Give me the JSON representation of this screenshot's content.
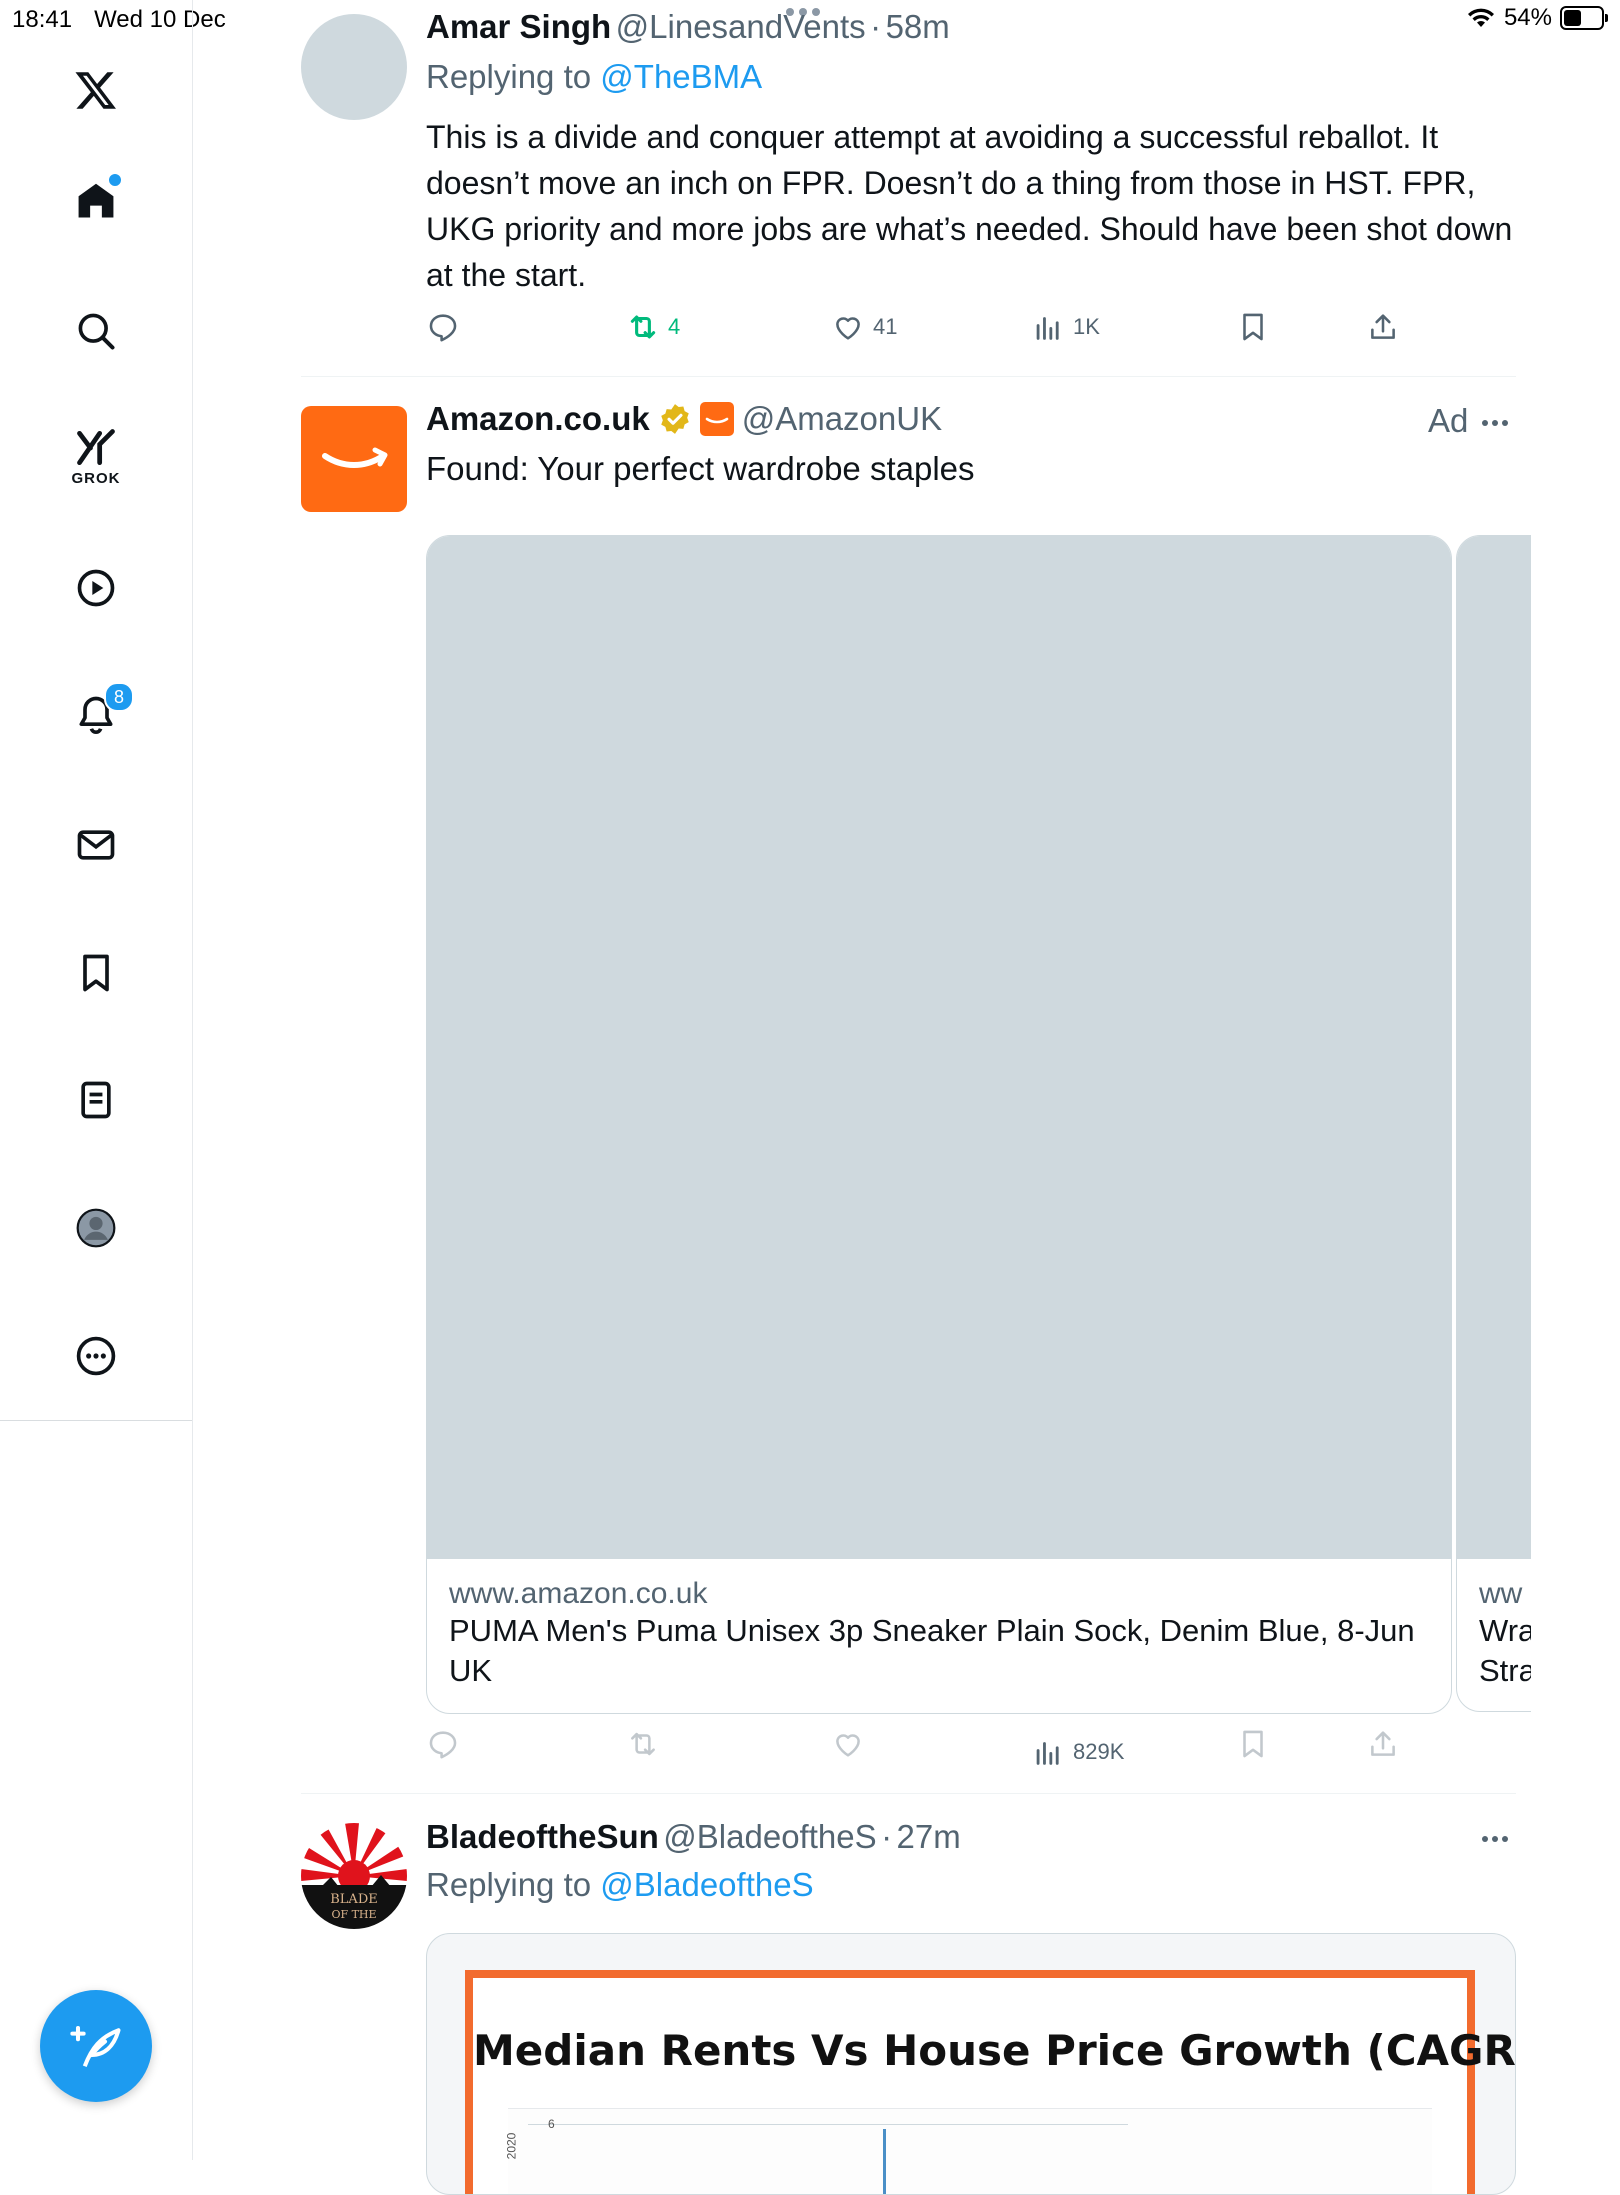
{
  "status": {
    "time": "18:41",
    "date": "Wed 10 Dec",
    "battery": "54%",
    "battery_level": 0.54
  },
  "sidebar": {
    "grok_label": "GROK",
    "notifications_count": "8"
  },
  "tweet1": {
    "name": "Amar Singh",
    "handle": "@LinesandVents",
    "sep": "·",
    "time": "58m",
    "replying_prefix": "Replying to",
    "replying_handle": "@TheBMA",
    "text": "This is a divide and conquer attempt at avoiding a successful reballot. It doesn’t move an inch on FPR. Doesn’t do a thing from those in HST. FPR, UKG priority and more jobs are what’s needed. Should have been shot down at the start.",
    "retweets": "4",
    "likes": "41",
    "views": "1K"
  },
  "ad": {
    "name": "Amazon.co.uk",
    "handle": "@AmazonUK",
    "ad_label": "Ad",
    "text": "Found: Your perfect wardrobe staples",
    "card1": {
      "domain": "www.amazon.co.uk",
      "title": "PUMA Men's Puma Unisex 3p Sneaker Plain Sock, Denim Blue, 8-Jun UK"
    },
    "card2": {
      "domain": "ww",
      "title_line1": "Wra",
      "title_line2": "Stra"
    },
    "views": "829K"
  },
  "tweet3": {
    "name": "BladeoftheSun",
    "handle": "@BladeoftheS",
    "sep": "·",
    "time": "27m",
    "replying_prefix": "Replying to",
    "replying_handle": "@BladeoftheS",
    "avatar_text_1": "BLADE",
    "avatar_text_2": "OF THE",
    "chart_title": "Median Rents Vs House Price Growth (CAGR)",
    "chart_tick": "6",
    "chart_side_label": "2020"
  },
  "colors": {
    "accent": "#1d9bf0",
    "retweet_green": "#00ba7c",
    "amazon_orange": "#ff6a13",
    "chart_border": "#f26b2e"
  }
}
